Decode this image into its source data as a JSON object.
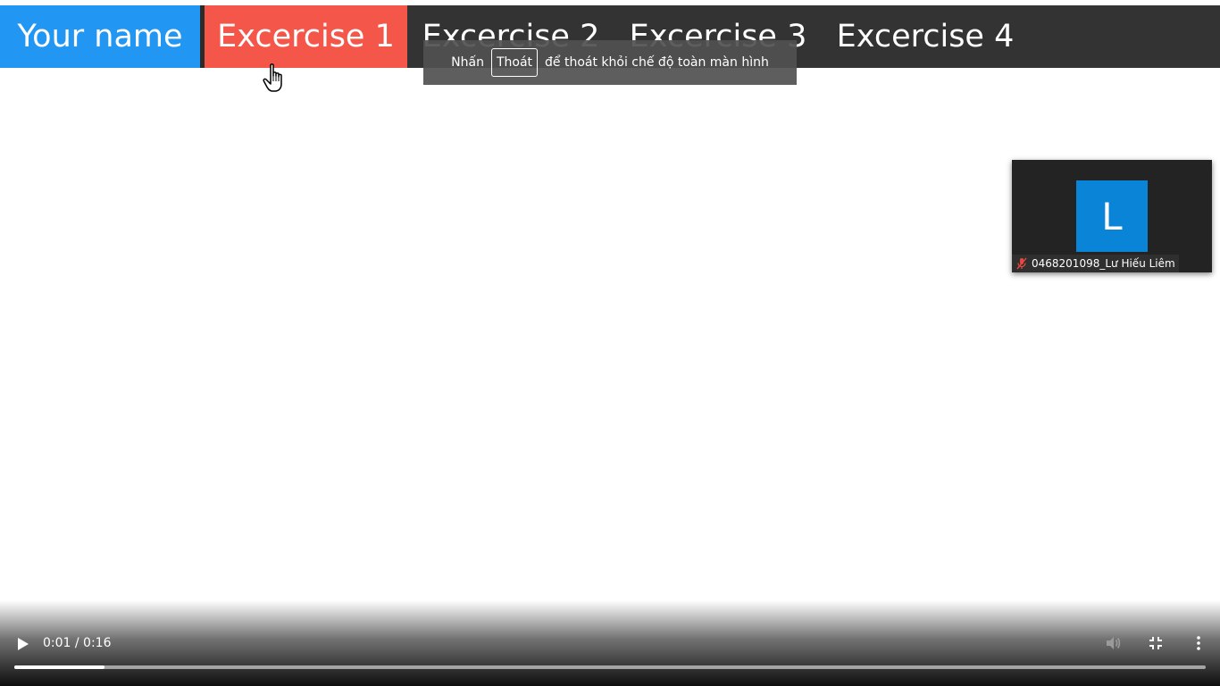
{
  "nav": {
    "home_label": "Your name",
    "items": [
      {
        "label": "Excercise 1",
        "active": true
      },
      {
        "label": "Excercise 2",
        "active": false
      },
      {
        "label": "Excercise 3",
        "active": false
      },
      {
        "label": "Excercise 4",
        "active": false
      }
    ]
  },
  "fullscreen_toast": {
    "prefix": "Nhấn",
    "key_label": "Thoát",
    "suffix": "để thoát khỏi chế độ toàn màn hình"
  },
  "participant": {
    "avatar_letter": "L",
    "name": "0468201098_Lư Hiếu Liêm",
    "mic": "muted",
    "mic_icon": "mic-muted-icon"
  },
  "video": {
    "time_display": "0:01 / 0:16",
    "progress_fraction": 0.076,
    "icons": [
      "play-icon",
      "volume-icon",
      "exit-fullscreen-icon",
      "more-vert-icon"
    ]
  },
  "colors": {
    "nav_background": "#333333",
    "home_accent": "#2196f3",
    "active_tab": "#f4574a",
    "avatar": "#0a84d6",
    "mic_muted": "#e5483f"
  }
}
